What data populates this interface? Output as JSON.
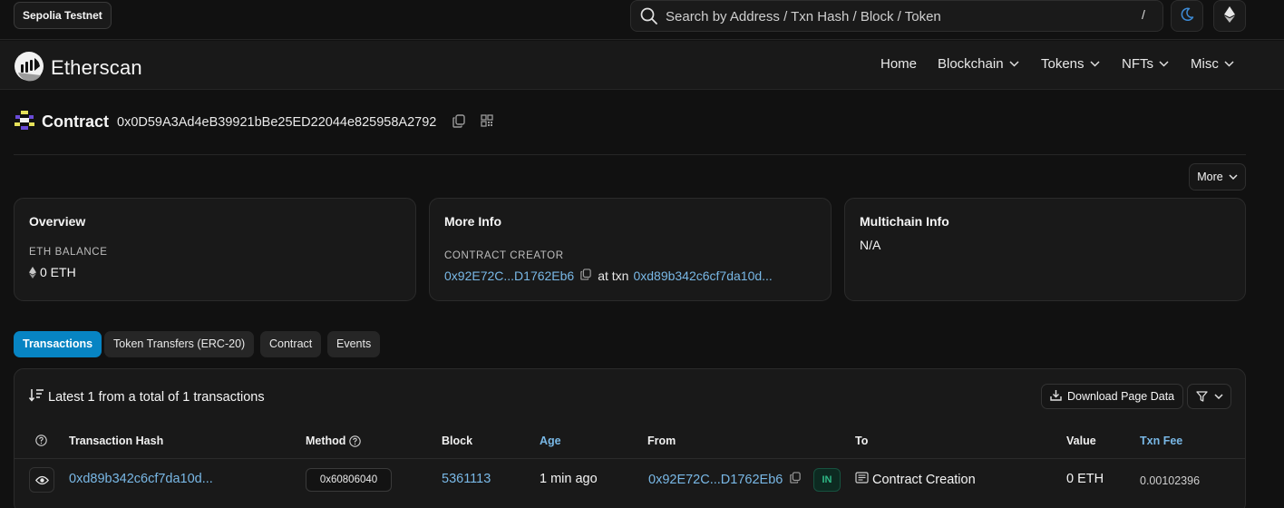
{
  "topbar": {
    "network": "Sepolia Testnet",
    "search_placeholder": "Search by Address / Txn Hash / Block / Token",
    "search_shortcut": "/"
  },
  "header": {
    "brand": "Etherscan",
    "nav": [
      {
        "label": "Home",
        "dropdown": false
      },
      {
        "label": "Blockchain",
        "dropdown": true
      },
      {
        "label": "Tokens",
        "dropdown": true
      },
      {
        "label": "NFTs",
        "dropdown": true
      },
      {
        "label": "Misc",
        "dropdown": true
      }
    ]
  },
  "contract": {
    "label": "Contract",
    "address": "0x0D59A3Ad4eB39921bBe25ED22044e825958A2792",
    "more_button": "More"
  },
  "cards": {
    "overview": {
      "title": "Overview",
      "balance_caption": "ETH BALANCE",
      "balance_value": "0 ETH"
    },
    "more_info": {
      "title": "More Info",
      "creator_caption": "CONTRACT CREATOR",
      "creator_address": "0x92E72C...D1762Eb6",
      "at_txn_label": "at txn",
      "creator_txn": "0xd89b342c6cf7da10d..."
    },
    "multichain": {
      "title": "Multichain Info",
      "value": "N/A"
    }
  },
  "tabs": [
    {
      "label": "Transactions",
      "active": true
    },
    {
      "label": "Token Transfers (ERC-20)",
      "active": false
    },
    {
      "label": "Contract",
      "active": false
    },
    {
      "label": "Events",
      "active": false
    }
  ],
  "transactions": {
    "summary": "Latest 1 from a total of 1 transactions",
    "download_label": "Download Page Data",
    "columns": {
      "hash": "Transaction Hash",
      "method": "Method",
      "block": "Block",
      "age": "Age",
      "from": "From",
      "to": "To",
      "value": "Value",
      "fee": "Txn Fee"
    },
    "rows": [
      {
        "hash": "0xd89b342c6cf7da10d...",
        "method": "0x60806040",
        "block": "5361113",
        "age": "1 min ago",
        "from": "0x92E72C...D1762Eb6",
        "direction": "IN",
        "to": "Contract Creation",
        "value": "0 ETH",
        "fee": "0.00102396"
      }
    ]
  },
  "colors": {
    "accent": "#0784c3",
    "link": "#79b8e6",
    "in_badge": "#2fb886",
    "background": "#111111",
    "card": "#191919"
  }
}
